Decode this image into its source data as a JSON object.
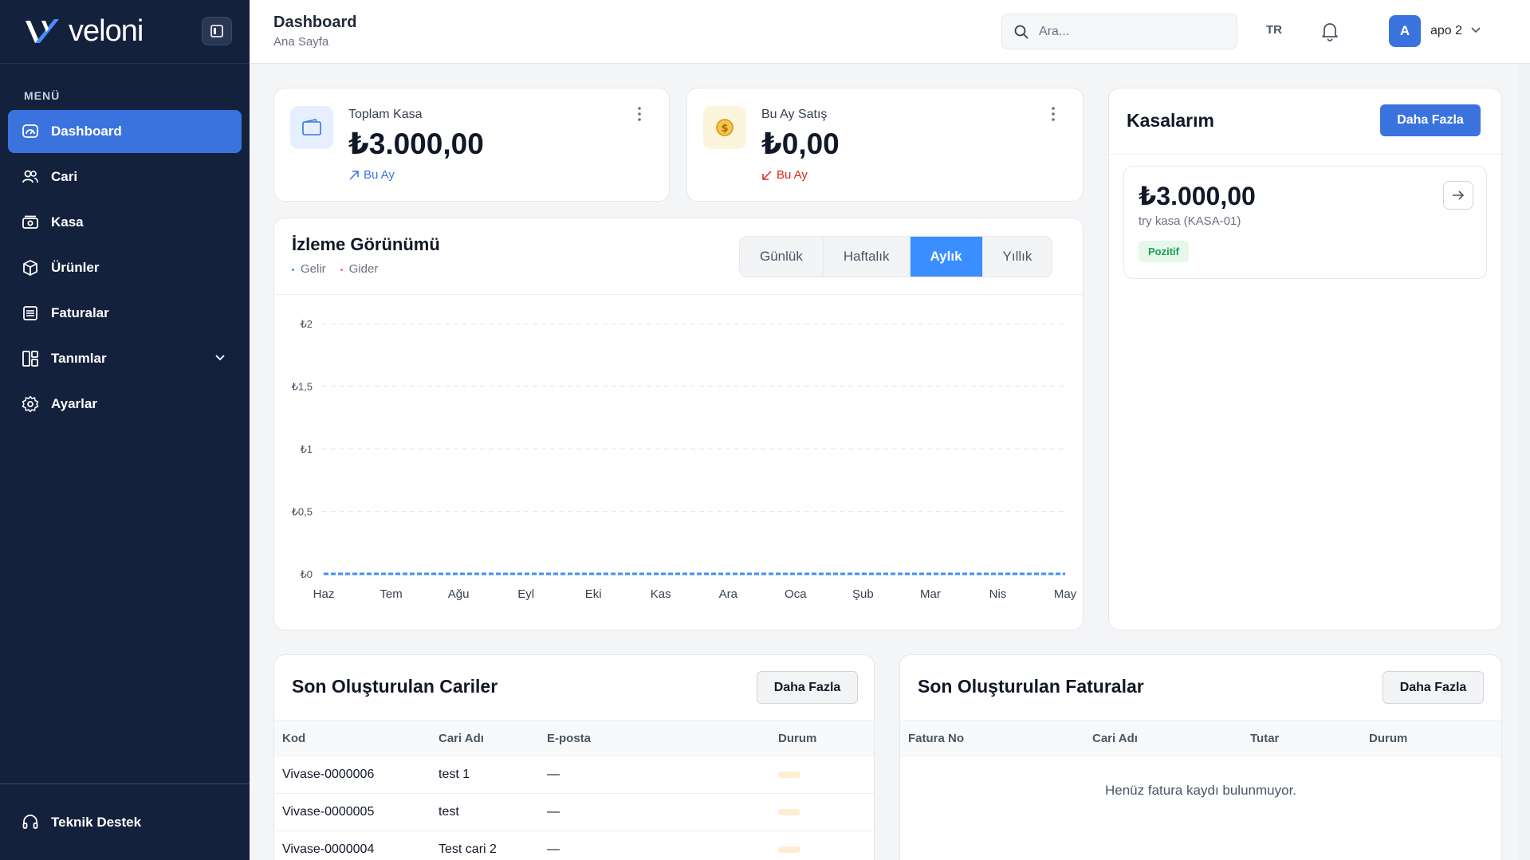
{
  "brand": {
    "name": "veloni"
  },
  "sidebar": {
    "menu_label": "MENÜ",
    "items": [
      {
        "label": "Dashboard",
        "icon": "dashboard-gauge-icon",
        "active": true
      },
      {
        "label": "Cari",
        "icon": "users-icon"
      },
      {
        "label": "Kasa",
        "icon": "cash-register-icon"
      },
      {
        "label": "Ürünler",
        "icon": "box-icon"
      },
      {
        "label": "Faturalar",
        "icon": "invoice-icon"
      },
      {
        "label": "Tanımlar",
        "icon": "grid-layout-icon",
        "has_children": true
      },
      {
        "label": "Ayarlar",
        "icon": "gear-icon"
      }
    ],
    "support_label": "Teknik Destek"
  },
  "header": {
    "title": "Dashboard",
    "breadcrumb": "Ana Sayfa",
    "search_placeholder": "Ara...",
    "language": "TR",
    "user": {
      "initial": "A",
      "name": "apo 2"
    }
  },
  "stats": [
    {
      "label": "Toplam Kasa",
      "value": "₺3.000,00",
      "trend": "Bu Ay",
      "trend_dir": "up",
      "color": "#3b73de"
    },
    {
      "label": "Bu Ay Satış",
      "value": "₺0,00",
      "trend": "Bu Ay",
      "trend_dir": "down",
      "color": "#dc2626"
    }
  ],
  "monitor": {
    "title": "İzleme Görünümü",
    "legend": [
      "Gelir",
      "Gider"
    ],
    "periods": [
      "Günlük",
      "Haftalık",
      "Aylık",
      "Yıllık"
    ],
    "active_period": "Aylık"
  },
  "chart_data": {
    "type": "line",
    "x": [
      "Haz",
      "Tem",
      "Ağu",
      "Eyl",
      "Eki",
      "Kas",
      "Ara",
      "Oca",
      "Şub",
      "Mar",
      "Nis",
      "May"
    ],
    "y_ticks": [
      "₺0",
      "₺0,5",
      "₺1",
      "₺1,5",
      "₺2"
    ],
    "ylim": [
      0,
      2
    ],
    "series": [
      {
        "name": "Gelir",
        "color": "#3b8eff",
        "values": [
          0,
          0,
          0,
          0,
          0,
          0,
          0,
          0,
          0,
          0,
          0,
          0
        ]
      },
      {
        "name": "Gider",
        "color": "#f87171",
        "values": [
          0,
          0,
          0,
          0,
          0,
          0,
          0,
          0,
          0,
          0,
          0,
          0
        ]
      }
    ],
    "grid": true
  },
  "kasalarim": {
    "title": "Kasalarım",
    "more_label": "Daha Fazla",
    "items": [
      {
        "amount": "₺3.000,00",
        "name": "try kasa (KASA-01)",
        "badge": "Pozitif"
      }
    ]
  },
  "cariler": {
    "title": "Son Oluşturulan Cariler",
    "more_label": "Daha Fazla",
    "columns": [
      "Kod",
      "Cari Adı",
      "E-posta",
      "Durum"
    ],
    "rows": [
      {
        "code": "Vivase-0000006",
        "name": "test 1",
        "email": "—"
      },
      {
        "code": "Vivase-0000005",
        "name": "test",
        "email": "—"
      },
      {
        "code": "Vivase-0000004",
        "name": "Test cari 2",
        "email": "—"
      }
    ]
  },
  "faturalar": {
    "title": "Son Oluşturulan Faturalar",
    "more_label": "Daha Fazla",
    "columns": [
      "Fatura No",
      "Cari Adı",
      "Tutar",
      "Durum"
    ],
    "empty_message": "Henüz fatura kaydı bulunmuyor."
  }
}
